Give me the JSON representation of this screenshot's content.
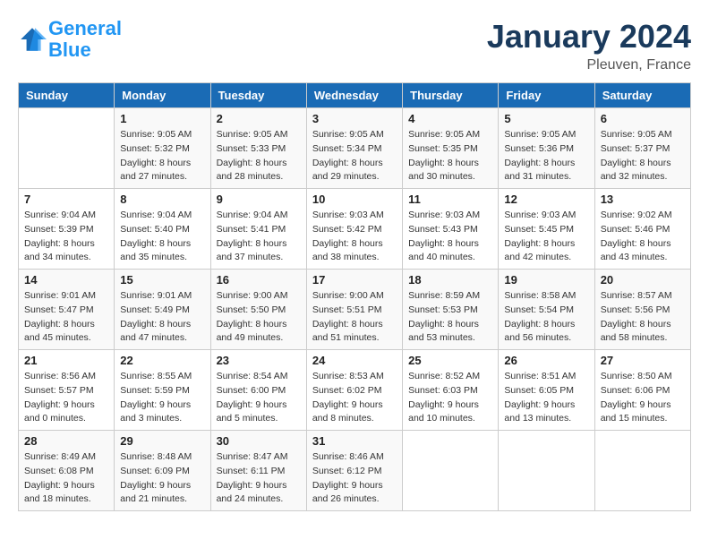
{
  "logo": {
    "text_general": "General",
    "text_blue": "Blue"
  },
  "title": "January 2024",
  "subtitle": "Pleuven, France",
  "headers": [
    "Sunday",
    "Monday",
    "Tuesday",
    "Wednesday",
    "Thursday",
    "Friday",
    "Saturday"
  ],
  "weeks": [
    [
      {
        "day": "",
        "sunrise": "",
        "sunset": "",
        "daylight": ""
      },
      {
        "day": "1",
        "sunrise": "Sunrise: 9:05 AM",
        "sunset": "Sunset: 5:32 PM",
        "daylight": "Daylight: 8 hours and 27 minutes."
      },
      {
        "day": "2",
        "sunrise": "Sunrise: 9:05 AM",
        "sunset": "Sunset: 5:33 PM",
        "daylight": "Daylight: 8 hours and 28 minutes."
      },
      {
        "day": "3",
        "sunrise": "Sunrise: 9:05 AM",
        "sunset": "Sunset: 5:34 PM",
        "daylight": "Daylight: 8 hours and 29 minutes."
      },
      {
        "day": "4",
        "sunrise": "Sunrise: 9:05 AM",
        "sunset": "Sunset: 5:35 PM",
        "daylight": "Daylight: 8 hours and 30 minutes."
      },
      {
        "day": "5",
        "sunrise": "Sunrise: 9:05 AM",
        "sunset": "Sunset: 5:36 PM",
        "daylight": "Daylight: 8 hours and 31 minutes."
      },
      {
        "day": "6",
        "sunrise": "Sunrise: 9:05 AM",
        "sunset": "Sunset: 5:37 PM",
        "daylight": "Daylight: 8 hours and 32 minutes."
      }
    ],
    [
      {
        "day": "7",
        "sunrise": "Sunrise: 9:04 AM",
        "sunset": "Sunset: 5:39 PM",
        "daylight": "Daylight: 8 hours and 34 minutes."
      },
      {
        "day": "8",
        "sunrise": "Sunrise: 9:04 AM",
        "sunset": "Sunset: 5:40 PM",
        "daylight": "Daylight: 8 hours and 35 minutes."
      },
      {
        "day": "9",
        "sunrise": "Sunrise: 9:04 AM",
        "sunset": "Sunset: 5:41 PM",
        "daylight": "Daylight: 8 hours and 37 minutes."
      },
      {
        "day": "10",
        "sunrise": "Sunrise: 9:03 AM",
        "sunset": "Sunset: 5:42 PM",
        "daylight": "Daylight: 8 hours and 38 minutes."
      },
      {
        "day": "11",
        "sunrise": "Sunrise: 9:03 AM",
        "sunset": "Sunset: 5:43 PM",
        "daylight": "Daylight: 8 hours and 40 minutes."
      },
      {
        "day": "12",
        "sunrise": "Sunrise: 9:03 AM",
        "sunset": "Sunset: 5:45 PM",
        "daylight": "Daylight: 8 hours and 42 minutes."
      },
      {
        "day": "13",
        "sunrise": "Sunrise: 9:02 AM",
        "sunset": "Sunset: 5:46 PM",
        "daylight": "Daylight: 8 hours and 43 minutes."
      }
    ],
    [
      {
        "day": "14",
        "sunrise": "Sunrise: 9:01 AM",
        "sunset": "Sunset: 5:47 PM",
        "daylight": "Daylight: 8 hours and 45 minutes."
      },
      {
        "day": "15",
        "sunrise": "Sunrise: 9:01 AM",
        "sunset": "Sunset: 5:49 PM",
        "daylight": "Daylight: 8 hours and 47 minutes."
      },
      {
        "day": "16",
        "sunrise": "Sunrise: 9:00 AM",
        "sunset": "Sunset: 5:50 PM",
        "daylight": "Daylight: 8 hours and 49 minutes."
      },
      {
        "day": "17",
        "sunrise": "Sunrise: 9:00 AM",
        "sunset": "Sunset: 5:51 PM",
        "daylight": "Daylight: 8 hours and 51 minutes."
      },
      {
        "day": "18",
        "sunrise": "Sunrise: 8:59 AM",
        "sunset": "Sunset: 5:53 PM",
        "daylight": "Daylight: 8 hours and 53 minutes."
      },
      {
        "day": "19",
        "sunrise": "Sunrise: 8:58 AM",
        "sunset": "Sunset: 5:54 PM",
        "daylight": "Daylight: 8 hours and 56 minutes."
      },
      {
        "day": "20",
        "sunrise": "Sunrise: 8:57 AM",
        "sunset": "Sunset: 5:56 PM",
        "daylight": "Daylight: 8 hours and 58 minutes."
      }
    ],
    [
      {
        "day": "21",
        "sunrise": "Sunrise: 8:56 AM",
        "sunset": "Sunset: 5:57 PM",
        "daylight": "Daylight: 9 hours and 0 minutes."
      },
      {
        "day": "22",
        "sunrise": "Sunrise: 8:55 AM",
        "sunset": "Sunset: 5:59 PM",
        "daylight": "Daylight: 9 hours and 3 minutes."
      },
      {
        "day": "23",
        "sunrise": "Sunrise: 8:54 AM",
        "sunset": "Sunset: 6:00 PM",
        "daylight": "Daylight: 9 hours and 5 minutes."
      },
      {
        "day": "24",
        "sunrise": "Sunrise: 8:53 AM",
        "sunset": "Sunset: 6:02 PM",
        "daylight": "Daylight: 9 hours and 8 minutes."
      },
      {
        "day": "25",
        "sunrise": "Sunrise: 8:52 AM",
        "sunset": "Sunset: 6:03 PM",
        "daylight": "Daylight: 9 hours and 10 minutes."
      },
      {
        "day": "26",
        "sunrise": "Sunrise: 8:51 AM",
        "sunset": "Sunset: 6:05 PM",
        "daylight": "Daylight: 9 hours and 13 minutes."
      },
      {
        "day": "27",
        "sunrise": "Sunrise: 8:50 AM",
        "sunset": "Sunset: 6:06 PM",
        "daylight": "Daylight: 9 hours and 15 minutes."
      }
    ],
    [
      {
        "day": "28",
        "sunrise": "Sunrise: 8:49 AM",
        "sunset": "Sunset: 6:08 PM",
        "daylight": "Daylight: 9 hours and 18 minutes."
      },
      {
        "day": "29",
        "sunrise": "Sunrise: 8:48 AM",
        "sunset": "Sunset: 6:09 PM",
        "daylight": "Daylight: 9 hours and 21 minutes."
      },
      {
        "day": "30",
        "sunrise": "Sunrise: 8:47 AM",
        "sunset": "Sunset: 6:11 PM",
        "daylight": "Daylight: 9 hours and 24 minutes."
      },
      {
        "day": "31",
        "sunrise": "Sunrise: 8:46 AM",
        "sunset": "Sunset: 6:12 PM",
        "daylight": "Daylight: 9 hours and 26 minutes."
      },
      {
        "day": "",
        "sunrise": "",
        "sunset": "",
        "daylight": ""
      },
      {
        "day": "",
        "sunrise": "",
        "sunset": "",
        "daylight": ""
      },
      {
        "day": "",
        "sunrise": "",
        "sunset": "",
        "daylight": ""
      }
    ]
  ]
}
